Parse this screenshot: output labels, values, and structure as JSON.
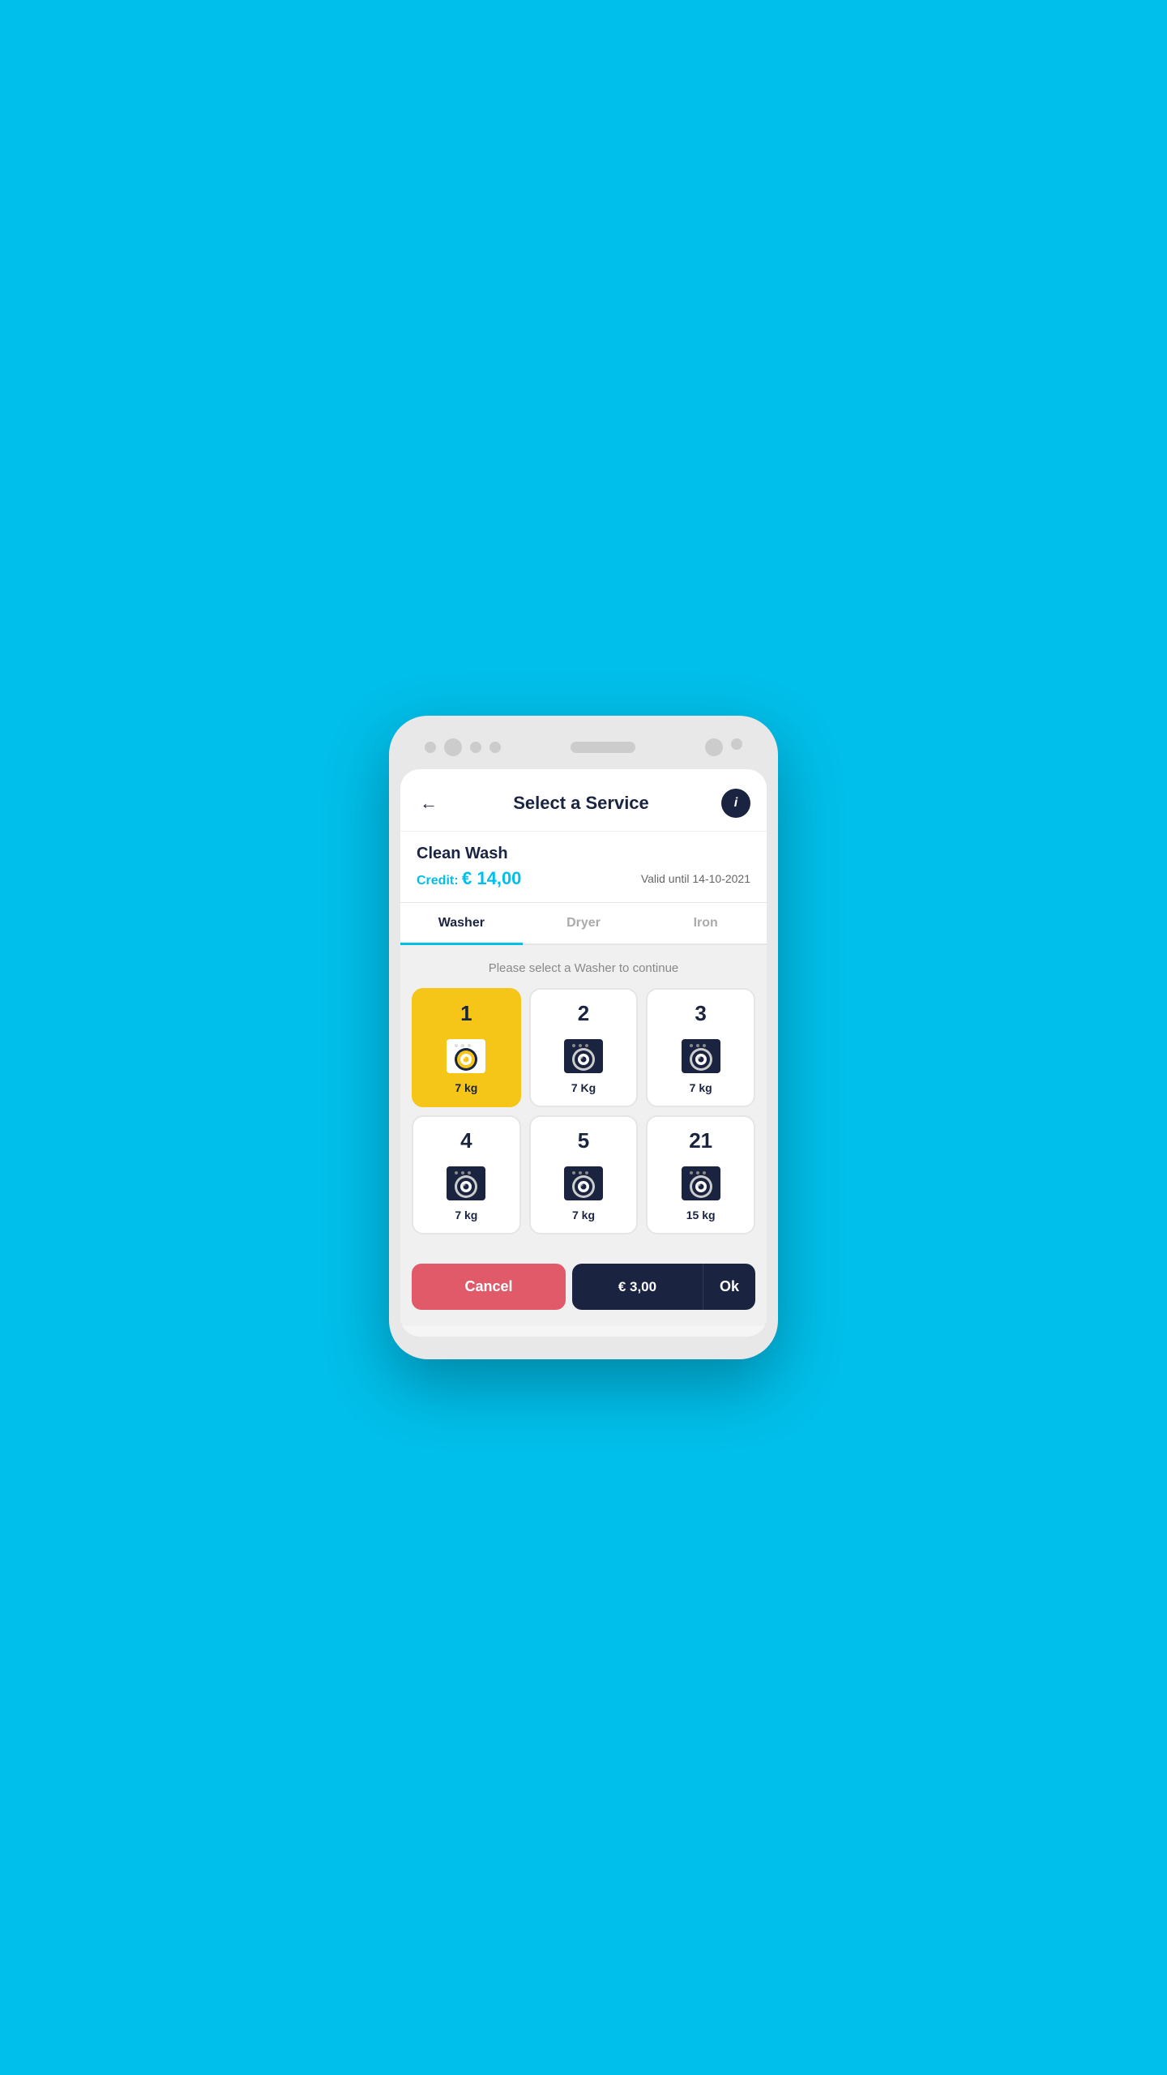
{
  "background_color": "#00BFEA",
  "header": {
    "back_label": "←",
    "title": "Select a Service",
    "info_label": "i"
  },
  "service": {
    "name": "Clean Wash",
    "credit_label": "Credit:",
    "credit_amount": "€ 14,00",
    "valid_label": "Valid until 14-10-2021"
  },
  "tabs": [
    {
      "id": "washer",
      "label": "Washer",
      "active": true
    },
    {
      "id": "dryer",
      "label": "Dryer",
      "active": false
    },
    {
      "id": "iron",
      "label": "Iron",
      "active": false
    }
  ],
  "instruction": "Please select a Washer to continue",
  "washers": [
    {
      "id": 1,
      "number": "1",
      "weight": "7 kg",
      "selected": true
    },
    {
      "id": 2,
      "number": "2",
      "weight": "7 Kg",
      "selected": false
    },
    {
      "id": 3,
      "number": "3",
      "weight": "7 kg",
      "selected": false
    },
    {
      "id": 4,
      "number": "4",
      "weight": "7 kg",
      "selected": false
    },
    {
      "id": 5,
      "number": "5",
      "weight": "7 kg",
      "selected": false
    },
    {
      "id": 21,
      "number": "21",
      "weight": "15 kg",
      "selected": false
    }
  ],
  "bottom": {
    "cancel_label": "Cancel",
    "price_label": "€ 3,00",
    "ok_label": "Ok"
  }
}
